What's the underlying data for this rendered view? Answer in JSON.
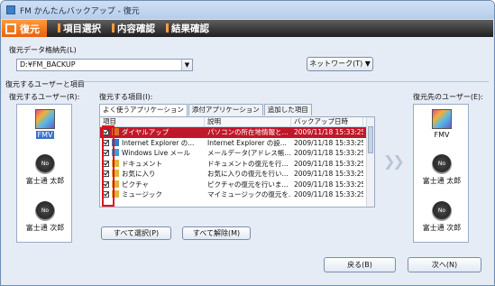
{
  "window": {
    "title": "FM かんたんバックアップ - 復元"
  },
  "header": {
    "logo": "復元",
    "tabs": [
      "項目選択",
      "内容確認",
      "結果確認"
    ]
  },
  "restore_source": {
    "label": "復元データ格納先(L)",
    "path": "D:¥FM_BACKUP",
    "network_button": "ネットワーク(T) ▼"
  },
  "section_label": "復元するユーザーと項目",
  "source_users": {
    "label": "復元するユーザー(R):",
    "items": [
      {
        "name": "FMV",
        "avatar": "fmv"
      },
      {
        "name": "富士通 太郎",
        "avatar": "no"
      },
      {
        "name": "富士通 次郎",
        "avatar": "no"
      }
    ]
  },
  "items": {
    "label": "復元する項目(I):",
    "tabs": [
      "よく使うアプリケーション",
      "添付アプリケーション",
      "追加した項目"
    ],
    "columns": [
      "項目",
      "説明",
      "バックアップ日時"
    ],
    "rows": [
      {
        "name": "ダイヤルアップ",
        "desc": "パソコンの所在地情報と...",
        "date": "2009/11/18 15:33:25",
        "icon_color": "#d9702a"
      },
      {
        "name": "Internet Explorer の...",
        "desc": "Internet Explorer の設...",
        "date": "2009/11/18 15:33:25",
        "icon_color": "#2f7bd6"
      },
      {
        "name": "Windows Live メール",
        "desc": "メールデータ(アドレス帳...",
        "date": "2009/11/18 15:33:25",
        "icon_color": "#3aa0d8"
      },
      {
        "name": "ドキュメント",
        "desc": "ドキュメントの復元を行...",
        "date": "2009/11/18 15:33:25",
        "icon_color": "#e4b33a"
      },
      {
        "name": "お気に入り",
        "desc": "お気に入りの復元を行い...",
        "date": "2009/11/18 15:33:25",
        "icon_color": "#e4b33a"
      },
      {
        "name": "ピクチャ",
        "desc": "ピクチャの復元を行いま...",
        "date": "2009/11/18 15:33:25",
        "icon_color": "#e4b33a"
      },
      {
        "name": "ミュージック",
        "desc": "マイミュージックの復元を...",
        "date": "2009/11/18 15:33:25",
        "icon_color": "#e4b33a"
      }
    ],
    "select_all": "すべて選択(P)",
    "clear_all": "すべて解除(M)"
  },
  "dest_users": {
    "label": "復元先のユーザー(E):",
    "items": [
      {
        "name": "FMV",
        "avatar": "fmv"
      },
      {
        "name": "富士通 太郎",
        "avatar": "no"
      },
      {
        "name": "富士通 次郎",
        "avatar": "no"
      }
    ]
  },
  "footer": {
    "back": "戻る(B)",
    "next": "次へ(N)"
  },
  "colors": {
    "selected_row": "#c0182b",
    "highlight_box": "#e0141e",
    "accent": "#ff9a3c"
  }
}
